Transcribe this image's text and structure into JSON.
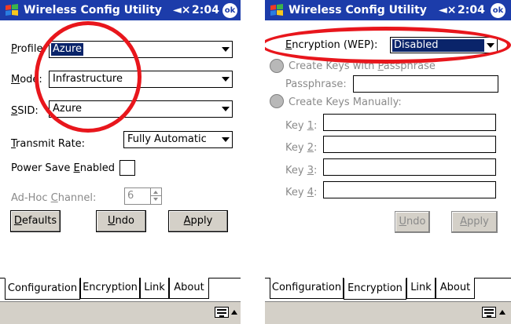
{
  "colors": {
    "titlebar": "#1c3caa",
    "highlight": "#0a246a",
    "annotation_red": "#e8161c",
    "disabled_gray": "#8a8a8a"
  },
  "left": {
    "titlebar": {
      "title": "Wireless Config Utility",
      "speaker": "◄×",
      "time": "2:04",
      "ok": "ok"
    },
    "profile": {
      "label": "Profile:",
      "value": "Azure"
    },
    "mode": {
      "label": "Mode:",
      "value": "Infrastructure"
    },
    "ssid": {
      "label": "SSID:",
      "value": "Azure"
    },
    "transmit_rate": {
      "label": "Transmit Rate:",
      "value": "Fully Automatic"
    },
    "power_save": {
      "label": "Power Save Enabled"
    },
    "adhoc_channel": {
      "label": "Ad-Hoc Channel:",
      "value": "6"
    },
    "buttons": {
      "defaults": "Defaults",
      "undo": "Undo",
      "apply": "Apply"
    },
    "tabs": [
      "Configuration",
      "Encryption",
      "Link",
      "About"
    ],
    "active_tab": "Configuration"
  },
  "right": {
    "titlebar": {
      "title": "Wireless Config Utility",
      "speaker": "◄×",
      "time": "2:04",
      "ok": "ok"
    },
    "encryption": {
      "label": "Encryption (WEP):",
      "value": "Disabled"
    },
    "passphrase_option": {
      "label": "Create Keys with Passphrase"
    },
    "passphrase": {
      "label": "Passphrase:",
      "value": ""
    },
    "manual_option": {
      "label": "Create Keys Manually:"
    },
    "keys": [
      {
        "label": "Key 1:",
        "value": ""
      },
      {
        "label": "Key 2:",
        "value": ""
      },
      {
        "label": "Key 3:",
        "value": ""
      },
      {
        "label": "Key 4:",
        "value": ""
      }
    ],
    "buttons": {
      "undo": "Undo",
      "apply": "Apply"
    },
    "tabs": [
      "Configuration",
      "Encryption",
      "Link",
      "About"
    ],
    "active_tab": "Encryption"
  }
}
